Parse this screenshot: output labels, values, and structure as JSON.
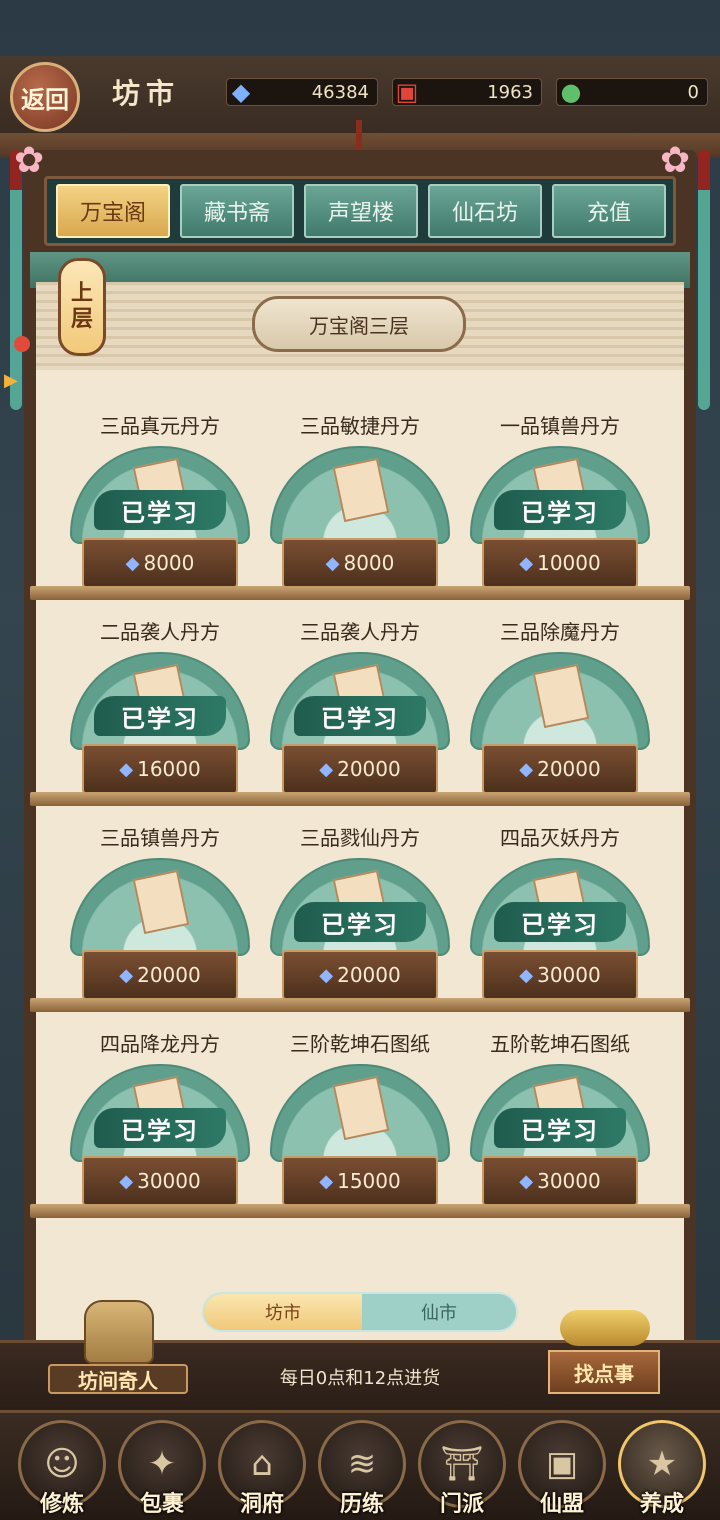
{
  "header": {
    "back_label": "返回",
    "title": "坊市",
    "resources": [
      {
        "icon": "spirit-crystal-icon",
        "value": "46384"
      },
      {
        "icon": "red-envelope-icon",
        "value": "1963"
      },
      {
        "icon": "jade-token-icon",
        "value": "0"
      }
    ]
  },
  "tabs": [
    {
      "label": "万宝阁",
      "active": true
    },
    {
      "label": "藏书斋",
      "active": false
    },
    {
      "label": "声望楼",
      "active": false
    },
    {
      "label": "仙石坊",
      "active": false
    },
    {
      "label": "充值",
      "active": false
    }
  ],
  "floor": {
    "up_label": "上层",
    "current": "万宝阁三层"
  },
  "learned_label": "已学习",
  "items": [
    {
      "name": "三品真元丹方",
      "price": "8000",
      "learned": true
    },
    {
      "name": "三品敏捷丹方",
      "price": "8000",
      "learned": false
    },
    {
      "name": "一品镇兽丹方",
      "price": "10000",
      "learned": true
    },
    {
      "name": "二品袭人丹方",
      "price": "16000",
      "learned": true
    },
    {
      "name": "三品袭人丹方",
      "price": "20000",
      "learned": true
    },
    {
      "name": "三品除魔丹方",
      "price": "20000",
      "learned": false
    },
    {
      "name": "三品镇兽丹方",
      "price": "20000",
      "learned": false
    },
    {
      "name": "三品戮仙丹方",
      "price": "20000",
      "learned": true
    },
    {
      "name": "四品灭妖丹方",
      "price": "30000",
      "learned": true
    },
    {
      "name": "四品降龙丹方",
      "price": "30000",
      "learned": true
    },
    {
      "name": "三阶乾坤石图纸",
      "price": "15000",
      "learned": false
    },
    {
      "name": "五阶乾坤石图纸",
      "price": "30000",
      "learned": true
    }
  ],
  "market_switch": {
    "left": "坊市",
    "right": "仙市",
    "selected": "坊市"
  },
  "restock_note": "每日0点和12点进货",
  "stranger_label": "坊间奇人",
  "chore_label": "找点事",
  "nav": [
    {
      "label": "修炼",
      "icon": "cultivator-avatar-icon",
      "active": false
    },
    {
      "label": "包裹",
      "icon": "bag-icon",
      "active": false
    },
    {
      "label": "洞府",
      "icon": "cave-house-icon",
      "active": false
    },
    {
      "label": "历练",
      "icon": "scroll-map-icon",
      "active": false
    },
    {
      "label": "门派",
      "icon": "sect-gate-icon",
      "active": false
    },
    {
      "label": "仙盟",
      "icon": "alliance-banner-icon",
      "active": false
    },
    {
      "label": "养成",
      "icon": "pentagram-icon",
      "active": true
    }
  ],
  "colors": {
    "tab_active": "#e9bc62",
    "tab_inactive": "#5a9888",
    "learned_banner": "#246b5a",
    "panel_bg": "#f1e7d3",
    "gem": "#8fb6ff"
  }
}
